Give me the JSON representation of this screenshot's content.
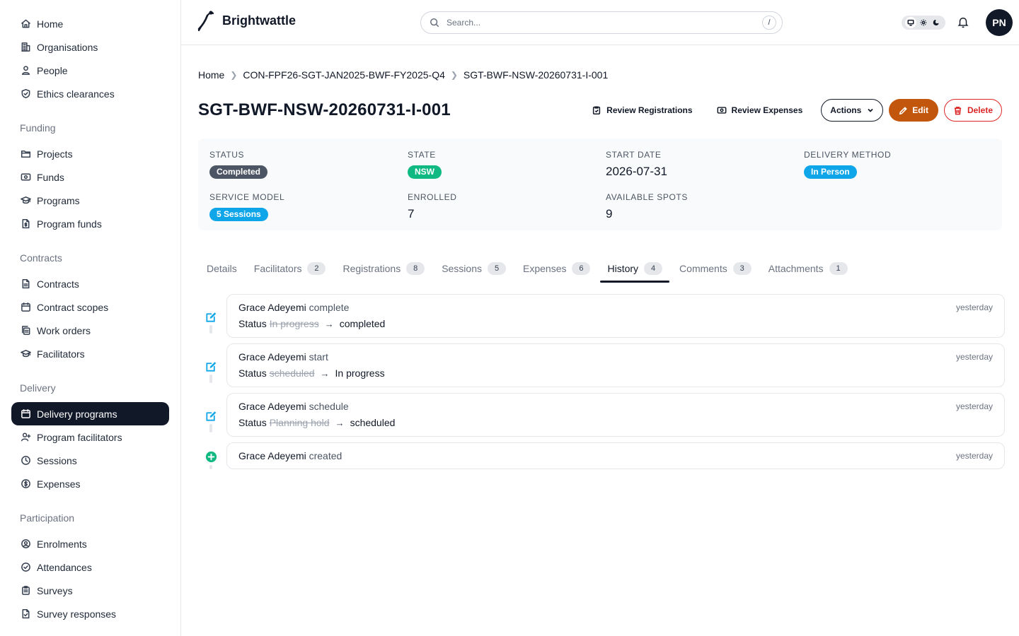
{
  "sidebar": {
    "top": [
      {
        "label": "Home",
        "icon": "home-icon"
      },
      {
        "label": "Organisations",
        "icon": "building-icon"
      },
      {
        "label": "People",
        "icon": "person-icon"
      },
      {
        "label": "Ethics clearances",
        "icon": "shield-check-icon"
      }
    ],
    "sections": [
      {
        "title": "Funding",
        "items": [
          {
            "label": "Projects",
            "icon": "folder-icon"
          },
          {
            "label": "Funds",
            "icon": "banknote-icon"
          },
          {
            "label": "Programs",
            "icon": "graduation-cap-icon"
          },
          {
            "label": "Program funds",
            "icon": "file-dollar-icon"
          }
        ]
      },
      {
        "title": "Contracts",
        "items": [
          {
            "label": "Contracts",
            "icon": "file-icon"
          },
          {
            "label": "Contract scopes",
            "icon": "calendar-icon"
          },
          {
            "label": "Work orders",
            "icon": "copy-icon"
          },
          {
            "label": "Facilitators",
            "icon": "graduation-cap-icon"
          }
        ]
      },
      {
        "title": "Delivery",
        "items": [
          {
            "label": "Delivery programs",
            "icon": "calendar-icon",
            "active": true
          },
          {
            "label": "Program facilitators",
            "icon": "user-plus-icon"
          },
          {
            "label": "Sessions",
            "icon": "clock-icon"
          },
          {
            "label": "Expenses",
            "icon": "dollar-circle-icon"
          }
        ]
      },
      {
        "title": "Participation",
        "items": [
          {
            "label": "Enrolments",
            "icon": "user-circle-icon"
          },
          {
            "label": "Attendances",
            "icon": "check-circle-icon"
          },
          {
            "label": "Surveys",
            "icon": "clipboard-icon"
          },
          {
            "label": "Survey responses",
            "icon": "file-check-icon"
          }
        ]
      }
    ]
  },
  "header": {
    "brand": "Brightwattle",
    "search_placeholder": "Search...",
    "search_shortcut": "/",
    "avatar_initials": "PN"
  },
  "breadcrumb": [
    "Home",
    "CON-FPF26-SGT-JAN2025-BWF-FY2025-Q4",
    "SGT-BWF-NSW-20260731-I-001"
  ],
  "page": {
    "title": "SGT-BWF-NSW-20260731-I-001",
    "review_registrations": "Review Registrations",
    "review_expenses": "Review Expenses",
    "actions": "Actions",
    "edit": "Edit",
    "delete": "Delete"
  },
  "summary": {
    "status_label": "Status",
    "status": "Completed",
    "status_color": "#4b5563",
    "state_label": "State",
    "state": "NSW",
    "state_color": "#10b981",
    "start_date_label": "Start date",
    "start_date": "2026-07-31",
    "delivery_method_label": "Delivery method",
    "delivery_method": "In Person",
    "delivery_color": "#0ea5e9",
    "service_model_label": "Service model",
    "service_model": "5 Sessions",
    "service_color": "#0ea5e9",
    "enrolled_label": "Enrolled",
    "enrolled": "7",
    "available_label": "Available spots",
    "available": "9"
  },
  "tabs": [
    {
      "label": "Details",
      "count": null
    },
    {
      "label": "Facilitators",
      "count": "2"
    },
    {
      "label": "Registrations",
      "count": "8"
    },
    {
      "label": "Sessions",
      "count": "5"
    },
    {
      "label": "Expenses",
      "count": "6"
    },
    {
      "label": "History",
      "count": "4",
      "active": true
    },
    {
      "label": "Comments",
      "count": "3"
    },
    {
      "label": "Attachments",
      "count": "1"
    }
  ],
  "history": [
    {
      "actor": "Grace Adeyemi",
      "verb": "complete",
      "time": "yesterday",
      "field": "Status",
      "from": "In progress",
      "to": "completed",
      "type": "edit"
    },
    {
      "actor": "Grace Adeyemi",
      "verb": "start",
      "time": "yesterday",
      "field": "Status",
      "from": "scheduled",
      "to": "In progress",
      "type": "edit"
    },
    {
      "actor": "Grace Adeyemi",
      "verb": "schedule",
      "time": "yesterday",
      "field": "Status",
      "from": "Planning hold",
      "to": "scheduled",
      "type": "edit"
    },
    {
      "actor": "Grace Adeyemi",
      "verb": "created",
      "time": "yesterday",
      "type": "create"
    }
  ],
  "colors": {
    "accent": "#c2560c",
    "danger": "#dc2626",
    "edit_icon": "#0ea5e9",
    "create_icon": "#10b981"
  }
}
